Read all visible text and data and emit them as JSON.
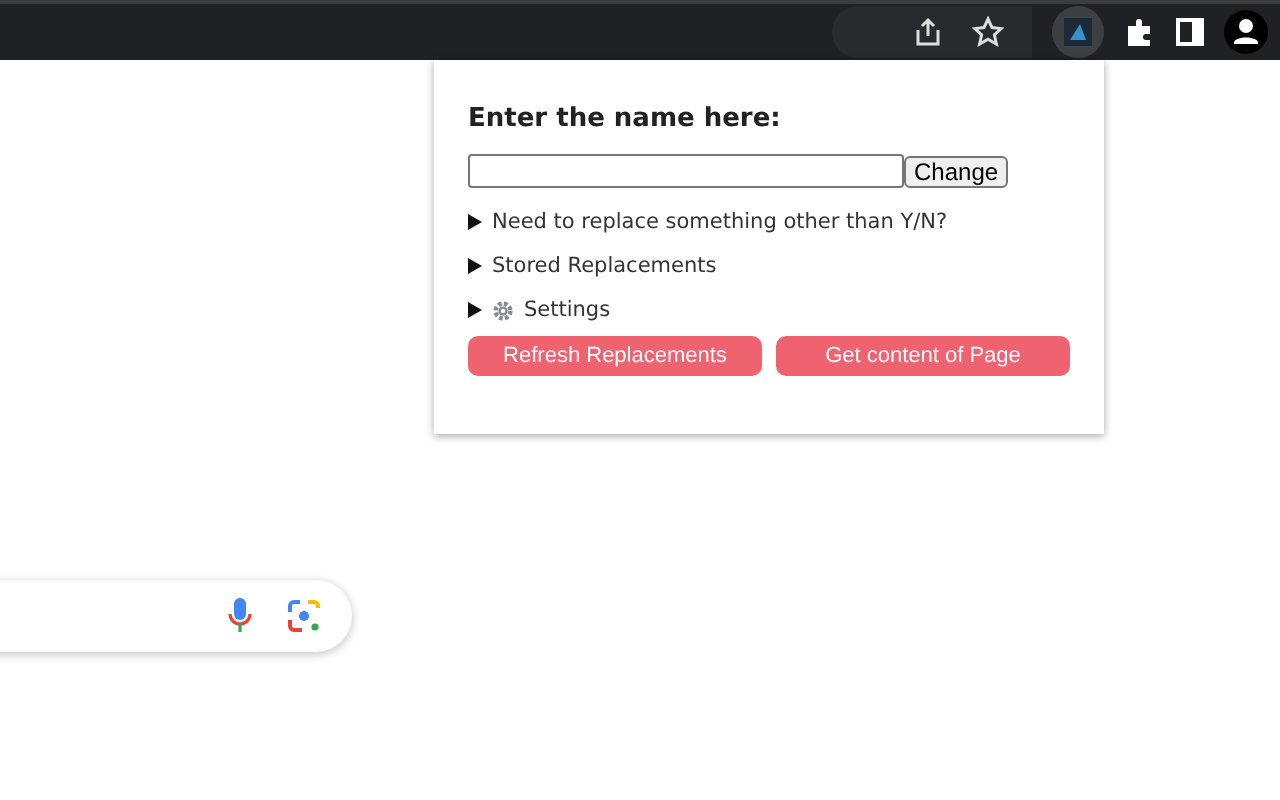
{
  "popup": {
    "heading": "Enter the name here:",
    "change_button": "Change",
    "sections": [
      {
        "label": "Need to replace something other than Y/N?",
        "expanded": false,
        "kind": "plain"
      },
      {
        "label": "Stored Replacements",
        "expanded": false,
        "kind": "plain"
      },
      {
        "label": "Settings",
        "expanded": false,
        "kind": "gear"
      }
    ],
    "buttons": [
      "Refresh Replacements",
      "Get content of Page"
    ]
  }
}
